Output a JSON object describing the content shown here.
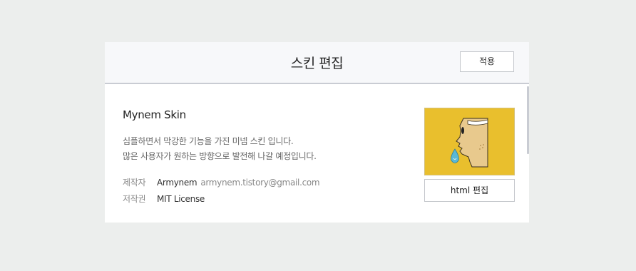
{
  "header": {
    "title": "스킨 편집",
    "apply_label": "적용"
  },
  "skin": {
    "name": "Mynem Skin",
    "description_lines": [
      "심플하면서 막강한 기능을 가진 미넴 스킨 입니다.",
      "많은 사용자가 원하는 방향으로 발전해 나갈 예정입니다."
    ],
    "author_label": "제작자",
    "author_name": "Armynem",
    "author_email": "armynem.tistory@gmail.com",
    "license_label": "저작권",
    "license_value": "MIT License"
  },
  "preview": {
    "icon": "face-with-tear-illustration",
    "edit_html_label": "html 편집"
  },
  "colors": {
    "page_background": "#eceeed",
    "header_background": "#f7f8fa",
    "thumbnail_background": "#e9bf2d",
    "tear_color": "#5ab8d6"
  }
}
